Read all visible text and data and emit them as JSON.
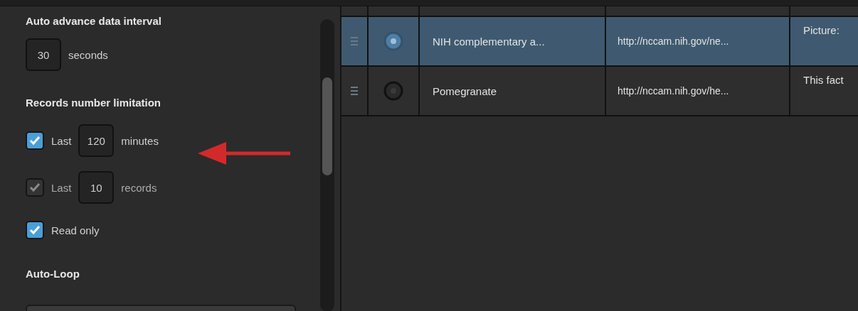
{
  "settings": {
    "interval_heading": "Auto advance data interval",
    "interval": {
      "value": "30",
      "unit": "seconds"
    },
    "limit_heading": "Records number limitation",
    "options": [
      {
        "kind": "count",
        "checked": true,
        "disabled": false,
        "label": "Last",
        "value": "120",
        "unit": "minutes"
      },
      {
        "kind": "count",
        "checked": true,
        "disabled": true,
        "label": "Last",
        "value": "10",
        "unit": "records"
      },
      {
        "kind": "plain",
        "checked": true,
        "disabled": false,
        "label": "Read only"
      }
    ],
    "loop_heading": "Auto-Loop"
  },
  "table": {
    "rows": [
      {
        "selected": true,
        "name": "NIH complementary a...",
        "url": "http://nccam.nih.gov/ne...",
        "column_5": "Picture:"
      },
      {
        "selected": false,
        "name": "Pomegranate",
        "url": "http://nccam.nih.gov/he...",
        "column_5": "This fact"
      }
    ]
  }
}
